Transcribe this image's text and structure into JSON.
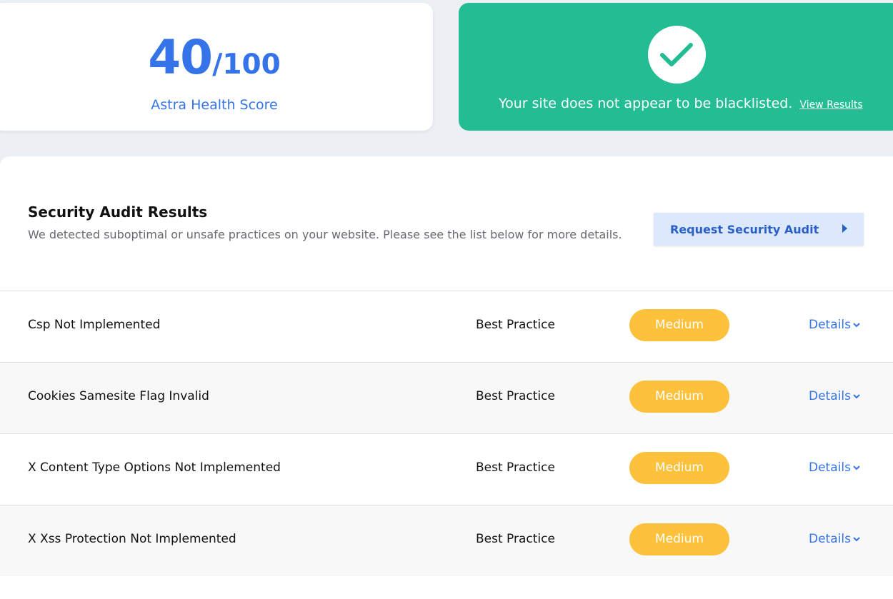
{
  "score": {
    "value": "40",
    "total": "/100",
    "label": "Astra Health Score"
  },
  "blacklist": {
    "message": "Your site does not appear to be blacklisted.",
    "link": "View Results",
    "icon": "check-icon"
  },
  "audit": {
    "title": "Security Audit Results",
    "description": "We detected suboptimal or unsafe practices on your website. Please see the list below for more details.",
    "request_button": "Request Security Audit",
    "rows": [
      {
        "name": "Csp Not Implemented",
        "category": "Best Practice",
        "severity": "Medium",
        "details": "Details"
      },
      {
        "name": "Cookies Samesite Flag Invalid",
        "category": "Best Practice",
        "severity": "Medium",
        "details": "Details"
      },
      {
        "name": "X Content Type Options Not Implemented",
        "category": "Best Practice",
        "severity": "Medium",
        "details": "Details"
      },
      {
        "name": "X Xss Protection Not Implemented",
        "category": "Best Practice",
        "severity": "Medium",
        "details": "Details"
      }
    ]
  },
  "colors": {
    "accent": "#3474e8",
    "success": "#24bc93",
    "medium_badge": "#fdc13b",
    "button_bg": "#dce8fb"
  }
}
